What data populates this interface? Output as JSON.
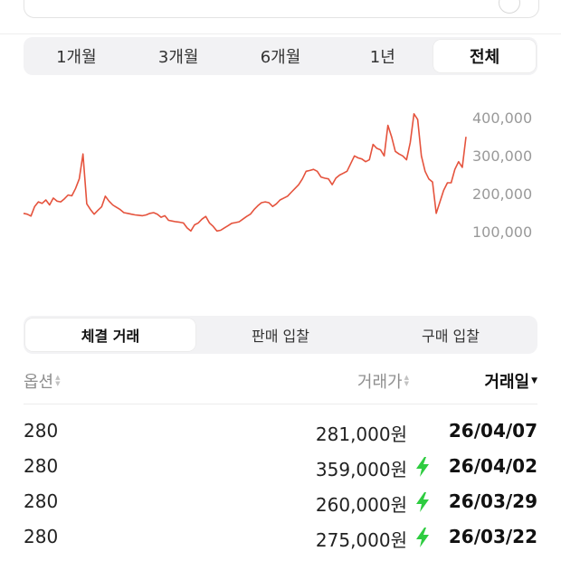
{
  "period_tabs": [
    {
      "label": "1개월",
      "active": false
    },
    {
      "label": "3개월",
      "active": false
    },
    {
      "label": "6개월",
      "active": false
    },
    {
      "label": "1년",
      "active": false
    },
    {
      "label": "전체",
      "active": true
    }
  ],
  "chart_data": {
    "type": "line",
    "line_color": "#e5533d",
    "y_ticks": [
      "400,000",
      "300,000",
      "200,000",
      "100,000"
    ],
    "y_tick_values": [
      400000,
      300000,
      200000,
      100000
    ],
    "ylim": [
      65000,
      415000
    ],
    "grid": false,
    "series": [
      {
        "values": [
          150000,
          148000,
          143000,
          168000,
          180000,
          176000,
          185000,
          172000,
          190000,
          182000,
          180000,
          188000,
          198000,
          196000,
          215000,
          240000,
          305000,
          175000,
          160000,
          148000,
          158000,
          167000,
          195000,
          182000,
          172000,
          166000,
          160000,
          152000,
          150000,
          148000,
          146000,
          145000,
          144000,
          146000,
          150000,
          152000,
          148000,
          140000,
          144000,
          132000,
          130000,
          128000,
          127000,
          125000,
          112000,
          104000,
          120000,
          125000,
          135000,
          142000,
          125000,
          116000,
          104000,
          106000,
          112000,
          118000,
          124000,
          126000,
          128000,
          135000,
          142000,
          148000,
          160000,
          170000,
          178000,
          180000,
          178000,
          168000,
          175000,
          185000,
          190000,
          195000,
          205000,
          215000,
          225000,
          240000,
          260000,
          262000,
          265000,
          260000,
          245000,
          242000,
          240000,
          225000,
          242000,
          250000,
          255000,
          260000,
          280000,
          300000,
          295000,
          292000,
          285000,
          290000,
          330000,
          320000,
          316000,
          300000,
          380000,
          350000,
          312000,
          305000,
          300000,
          290000,
          335000,
          410000,
          395000,
          300000,
          260000,
          240000,
          232000,
          150000,
          180000,
          210000,
          230000,
          230000,
          265000,
          285000,
          270000,
          350000
        ]
      }
    ]
  },
  "trade_tabs": [
    {
      "label": "체결 거래",
      "active": true
    },
    {
      "label": "판매 입찰",
      "active": false
    },
    {
      "label": "구매 입찰",
      "active": false
    }
  ],
  "table": {
    "headers": {
      "option": "옵션",
      "price": "거래가",
      "date": "거래일"
    },
    "sort_icons": {
      "option": "sort-icon",
      "price": "sort-icon",
      "date": "sort-desc-icon"
    },
    "rows": [
      {
        "option": "280",
        "price": "281,000원",
        "quick": false,
        "date": "26/04/07"
      },
      {
        "option": "280",
        "price": "359,000원",
        "quick": true,
        "date": "26/04/02"
      },
      {
        "option": "280",
        "price": "260,000원",
        "quick": true,
        "date": "26/03/29"
      },
      {
        "option": "280",
        "price": "275,000원",
        "quick": true,
        "date": "26/03/22"
      }
    ],
    "bolt_color": "#2ecc40"
  }
}
